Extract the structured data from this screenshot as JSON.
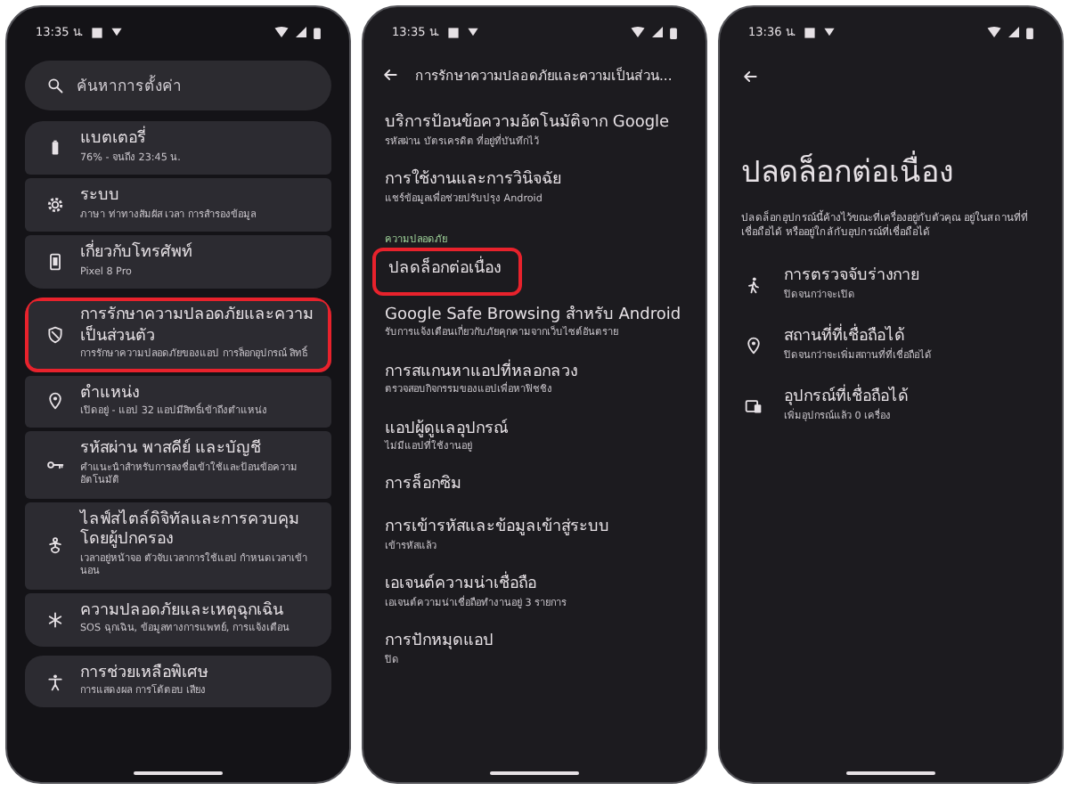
{
  "screens": [
    {
      "kind": "settings",
      "time": "13:35 น.",
      "search": {
        "placeholder": "ค้นหาการตั้งค่า"
      },
      "groups": [
        {
          "items": [
            {
              "title": "แบตเตอรี่",
              "subtitle": "76% - จนถึง 23:45 น.",
              "highlighted": false
            },
            {
              "title": "ระบบ",
              "subtitle": "ภาษา ท่าทางสัมผัส เวลา การสำรองข้อมูล",
              "highlighted": false
            },
            {
              "title": "เกี่ยวกับโทรศัพท์",
              "subtitle": "Pixel 8 Pro",
              "highlighted": false
            }
          ]
        },
        {
          "items": [
            {
              "title": "การรักษาความปลอดภัยและความเป็นส่วนตัว",
              "subtitle": "การรักษาความปลอดภัยของแอป การล็อกอุปกรณ์ สิทธิ์",
              "highlighted": true
            },
            {
              "title": "ตำแหน่ง",
              "subtitle": "เปิดอยู่ - แอป 32 แอปมีสิทธิ์เข้าถึงตำแหน่ง",
              "highlighted": false
            },
            {
              "title": "รหัสผ่าน พาสคีย์ และบัญชี",
              "subtitle": "คำแนะนำสำหรับการลงชื่อเข้าใช้และป้อนข้อความอัตโนมัติ",
              "highlighted": false
            },
            {
              "title": "ไลฟ์สไตล์ดิจิทัลและการควบคุมโดยผู้ปกครอง",
              "subtitle": "เวลาอยู่หน้าจอ ตัวจับเวลาการใช้แอป กำหนดเวลาเข้านอน",
              "highlighted": false
            },
            {
              "title": "ความปลอดภัยและเหตุฉุกเฉิน",
              "subtitle": "SOS ฉุกเฉิน, ข้อมูลทางการแพทย์, การแจ้งเตือน",
              "highlighted": false
            }
          ]
        },
        {
          "items": [
            {
              "title": "การช่วยเหลือพิเศษ",
              "subtitle": "การแสดงผล การโต้ตอบ เสียง",
              "highlighted": false
            }
          ]
        }
      ]
    },
    {
      "kind": "list",
      "time": "13:35 น.",
      "title": "การรักษาความปลอดภัยและความเป็นส่วน...",
      "items": [
        {
          "kind": "entry",
          "title": "บริการป้อนข้อความอัตโนมัติจาก Google",
          "subtitle": "รหัสผ่าน บัตรเครดิต ที่อยู่ที่บันทึกไว้",
          "highlighted": false
        },
        {
          "kind": "entry",
          "title": "การใช้งานและการวินิจฉัย",
          "subtitle": "แชร์ข้อมูลเพื่อช่วยปรับปรุง Android",
          "highlighted": false
        },
        {
          "kind": "header",
          "title": "ความปลอดภัย"
        },
        {
          "kind": "entry",
          "title": "ปลดล็อกต่อเนื่อง",
          "highlighted": true
        },
        {
          "kind": "entry",
          "title": "Google Safe Browsing สำหรับ Android",
          "subtitle": "รับการแจ้งเตือนเกี่ยวกับภัยคุกคามจากเว็บไซต์อันตราย",
          "highlighted": false
        },
        {
          "kind": "entry",
          "title": "การสแกนหาแอปที่หลอกลวง",
          "subtitle": "ตรวจสอบกิจกรรมของแอปเพื่อหาฟิชชิง",
          "highlighted": false
        },
        {
          "kind": "entry",
          "title": "แอปผู้ดูแลอุปกรณ์",
          "subtitle": "ไม่มีแอปที่ใช้งานอยู่",
          "highlighted": false
        },
        {
          "kind": "entry",
          "title": "การล็อกซิม",
          "highlighted": false
        },
        {
          "kind": "entry",
          "title": "การเข้ารหัสและข้อมูลเข้าสู่ระบบ",
          "subtitle": "เข้ารหัสแล้ว",
          "highlighted": false
        },
        {
          "kind": "entry",
          "title": "เอเจนต์ความน่าเชื่อถือ",
          "subtitle": "เอเจนต์ความน่าเชื่อถือทำงานอยู่ 3 รายการ",
          "highlighted": false
        },
        {
          "kind": "entry",
          "title": "การปักหมุดแอป",
          "subtitle": "ปิด",
          "highlighted": false
        }
      ]
    },
    {
      "kind": "detail",
      "time": "13:36 น.",
      "title": "ปลดล็อกต่อเนื่อง",
      "description": "ปลดล็อกอุปกรณ์นี้ค้างไว้ขณะที่เครื่องอยู่กับตัวคุณ อยู่ในสถานที่ที่เชื่อถือได้ หรืออยู่ใกล้กับอุปกรณ์ที่เชื่อถือได้",
      "items": [
        {
          "title": "การตรวจจับร่างกาย",
          "subtitle": "ปิดจนกว่าจะเปิด"
        },
        {
          "title": "สถานที่ที่เชื่อถือได้",
          "subtitle": "ปิดจนกว่าจะเพิ่มสถานที่ที่เชื่อถือได้"
        },
        {
          "title": "อุปกรณ์ที่เชื่อถือได้",
          "subtitle": "เพิ่มอุปกรณ์แล้ว 0 เครื่อง"
        }
      ]
    }
  ]
}
